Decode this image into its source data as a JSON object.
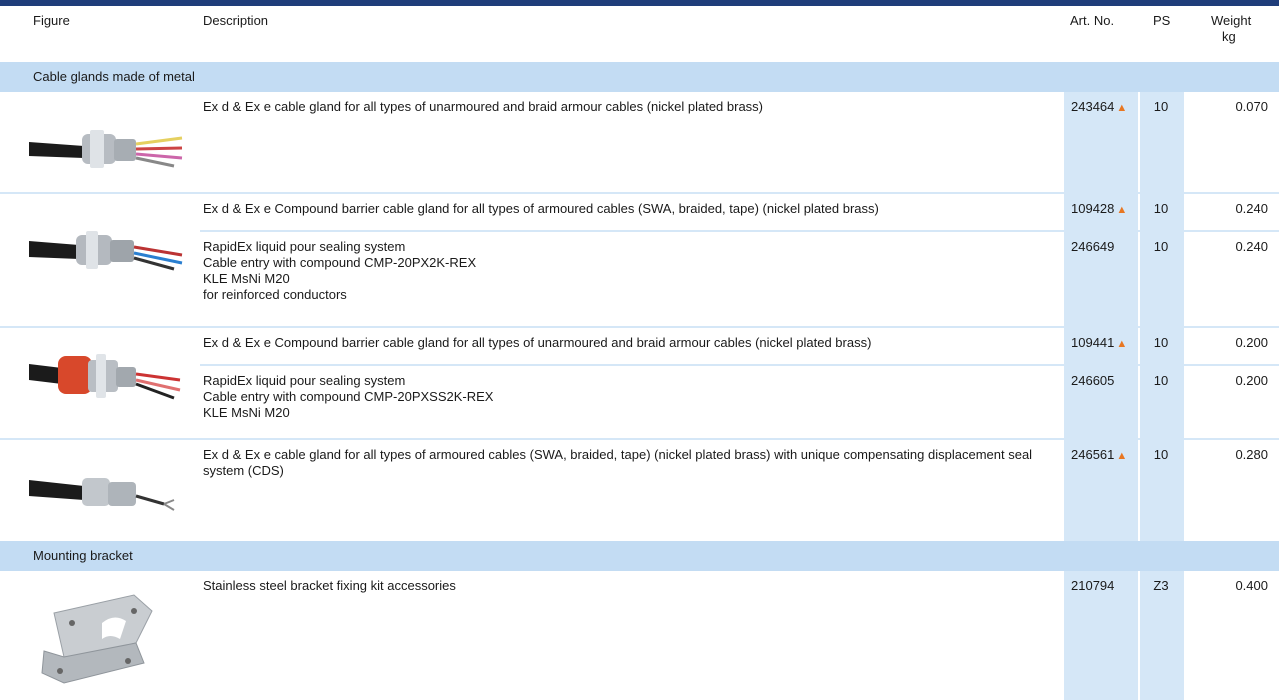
{
  "header": {
    "figure": "Figure",
    "description": "Description",
    "art_no": "Art. No.",
    "ps": "PS",
    "weight": "Weight",
    "weight_unit": "kg"
  },
  "sections": [
    {
      "title": "Cable glands made of metal"
    },
    {
      "title": "Mounting bracket"
    }
  ],
  "rows": [
    {
      "description": "Ex d & Ex e cable gland for all types of unarmoured and braid armour cables (nickel plated brass)",
      "art_no": "243464",
      "new": "▲",
      "ps": "10",
      "weight": "0.070"
    },
    {
      "description": "Ex d & Ex e Compound barrier cable gland for all types of armoured cables (SWA, braided, tape) (nickel plated brass)",
      "art_no": "109428",
      "new": "▲",
      "ps": "10",
      "weight": "0.240"
    },
    {
      "description": "RapidEx liquid pour sealing system\nCable entry with compound CMP-20PX2K-REX\nKLE MsNi M20\nfor reinforced conductors",
      "art_no": "246649",
      "new": "",
      "ps": "10",
      "weight": "0.240"
    },
    {
      "description": "Ex d & Ex e Compound barrier cable gland for all types of unarmoured and braid armour cables (nickel plated brass)",
      "art_no": "109441",
      "new": "▲",
      "ps": "10",
      "weight": "0.200"
    },
    {
      "description": "RapidEx liquid pour sealing system\nCable entry with compound CMP-20PXSS2K-REX\nKLE MsNi M20",
      "art_no": "246605",
      "new": "",
      "ps": "10",
      "weight": "0.200"
    },
    {
      "description": "Ex d & Ex e cable gland for all types of armoured cables (SWA, braided, tape) (nickel plated brass) with unique compensating displacement seal system (CDS)",
      "art_no": "246561",
      "new": "▲",
      "ps": "10",
      "weight": "0.280"
    },
    {
      "description": "Stainless steel bracket fixing kit accessories",
      "art_no": "210794",
      "new": "",
      "ps": "Z3",
      "weight": "0.400"
    }
  ],
  "colors": {
    "brand_bar": "#1f3d7a",
    "section_bg": "#c3dcf3",
    "column_bg": "#d5e7f7",
    "new_marker": "#e87722"
  }
}
